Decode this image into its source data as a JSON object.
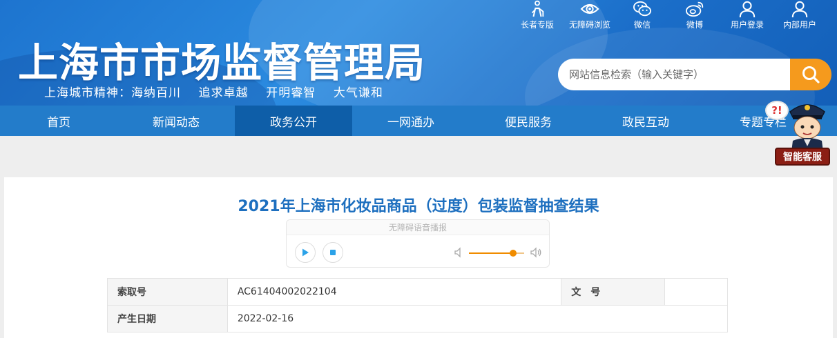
{
  "header": {
    "title": "上海市市场监督管理局",
    "slogan": "上海城市精神：海纳百川    追求卓越    开明睿智    大气谦和"
  },
  "tools": [
    {
      "label": "长者专版",
      "icon": "elder-icon"
    },
    {
      "label": "无障碍浏览",
      "icon": "eye-icon"
    },
    {
      "label": "微信",
      "icon": "wechat-icon"
    },
    {
      "label": "微博",
      "icon": "weibo-icon"
    },
    {
      "label": "用户登录",
      "icon": "user-icon"
    },
    {
      "label": "内部用户",
      "icon": "user-icon"
    }
  ],
  "search": {
    "placeholder": "网站信息检索（输入关键字）",
    "icon": "search-icon"
  },
  "nav": {
    "items": [
      "首页",
      "新闻动态",
      "政务公开",
      "一网通办",
      "便民服务",
      "政民互动",
      "专题专栏"
    ],
    "active": "政务公开"
  },
  "mascot": {
    "bubble": "?!",
    "label": "智能客服"
  },
  "article": {
    "title": "2021年上海市化妆品商品（过度）包装监督抽查结果",
    "player": {
      "title": "无障碍语音播报",
      "volume": 0.8
    },
    "info": {
      "index_label": "索取号",
      "index_value": "AC61404002022104",
      "doc_label": "文　号",
      "doc_value": "",
      "date_label": "产生日期",
      "date_value": "2022-02-16"
    }
  },
  "colors": {
    "header_blue": "#1d74cf",
    "nav_blue": "#237cca",
    "nav_active": "#0e5ea8",
    "title_blue": "#1d6fbf",
    "search_orange": "#f59a1d",
    "player_orange": "#f08c00",
    "play_blue": "#2ba2e8"
  }
}
